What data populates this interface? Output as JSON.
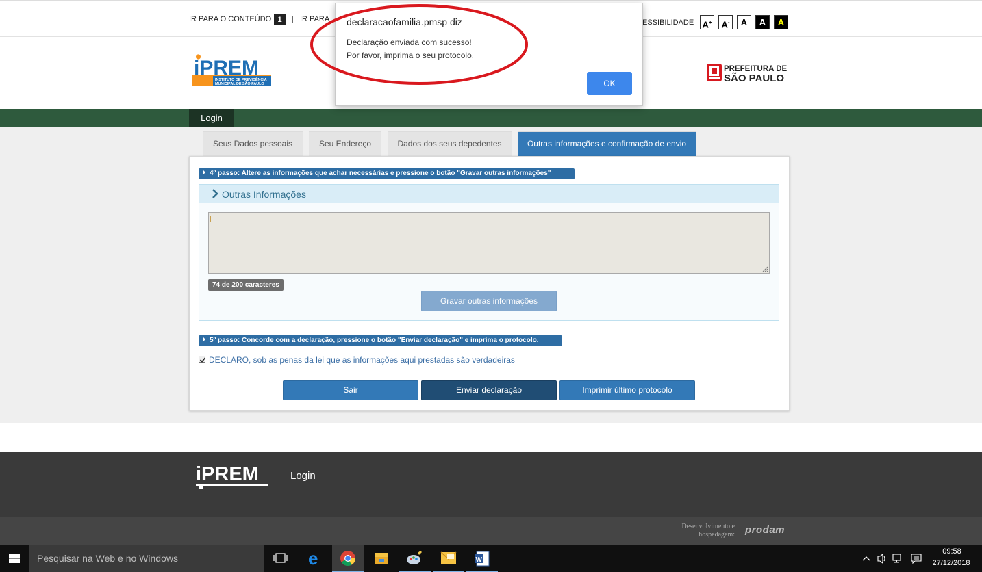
{
  "topbar": {
    "skip_content": "IR PARA O CONTEÚDO",
    "skip_content_key": "1",
    "separator": "|",
    "skip_menu_partial": "IR PARA",
    "accessibility_partial": "ESSIBILIDADE",
    "font_increase": "A",
    "font_increase_sup": "+",
    "font_decrease": "A",
    "font_decrease_sup": "-",
    "font_reset": "A",
    "contrast_dark": "A",
    "contrast_yellow": "A"
  },
  "header": {
    "logo_iprem": "iPREM",
    "logo_iprem_sub1": "INSTITUTO DE PREVIDÊNCIA",
    "logo_iprem_sub2": "MUNICIPAL DE SÃO PAULO",
    "logo_sp_line1": "PREFEITURA DE",
    "logo_sp_line2": "SÃO PAULO"
  },
  "nav": {
    "login": "Login"
  },
  "tabs": [
    {
      "label": "Seus Dados pessoais",
      "active": false
    },
    {
      "label": "Seu Endereço",
      "active": false
    },
    {
      "label": "Dados dos seus depedentes",
      "active": false
    },
    {
      "label": "Outras informações e confirmação de envio",
      "active": true
    }
  ],
  "form": {
    "step4": "4º passo: Altere as informações que achar necessárias e pressione o botão \"Gravar outras informações\"",
    "section_title": "Outras Informações",
    "textarea_value": "",
    "char_count": "74 de 200 caracteres",
    "save_button": "Gravar outras informações",
    "step5": "5º passo: Concorde com a declaração, pressione o botão \"Enviar declaração\" e imprima o protocolo.",
    "declaro_checked": true,
    "declaro_text": "DECLARO, sob as penas da lei que as informações aqui prestadas são verdadeiras",
    "exit_button": "Sair",
    "send_button": "Enviar declaração",
    "print_button": "Imprimir último protocolo"
  },
  "footer": {
    "logo": "iPREM",
    "login": "Login",
    "dev_line1": "Desenvolvimento e",
    "dev_line2": "hospedagem:",
    "prodam": "prodam"
  },
  "dialog": {
    "title": "declaracaofamilia.pmsp diz",
    "message_line1": "Declaração enviada com sucesso!",
    "message_line2": "Por favor, imprima o seu protocolo.",
    "ok_button": "OK"
  },
  "taskbar": {
    "search_placeholder": "Pesquisar na Web e no Windows",
    "apps": [
      "task-view-icon",
      "edge-icon",
      "chrome-icon",
      "file-explorer-icon",
      "paint-icon",
      "outlook-icon",
      "word-icon"
    ],
    "time": "09:58",
    "date": "27/12/2018"
  },
  "colors": {
    "nav_green": "#2e5a3d",
    "primary_blue": "#3379b7",
    "dark_blue": "#204d74",
    "annotation_red": "#d9181e",
    "dialog_ok": "#3d87ec"
  }
}
